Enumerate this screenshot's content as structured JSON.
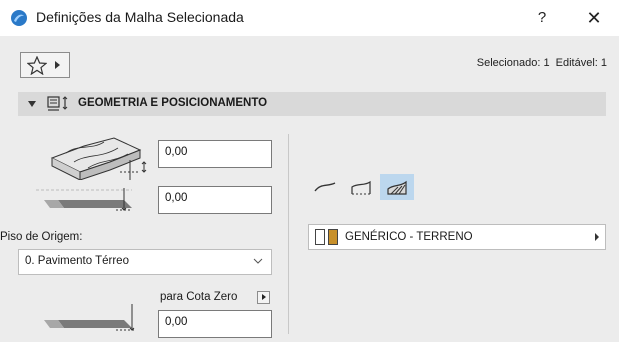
{
  "window": {
    "title": "Definições da Malha Selecionada",
    "help_label": "?",
    "close_label": "✕"
  },
  "toolbar": {
    "favorites_icon": "star-icon",
    "selected_label": "Selecionado: 1",
    "editable_label": "Editável: 1"
  },
  "section": {
    "title": "GEOMETRIA E POSICIONAMENTO",
    "icon": "mesh-geometry-icon"
  },
  "geometry": {
    "top_offset_value": "0,00",
    "bottom_offset_value": "0,00",
    "origin_story_label": "Piso de Origem:",
    "origin_story_value": "0. Pavimento Térreo",
    "zero_level_label": "para Cota Zero",
    "zero_level_value": "0,00"
  },
  "structure": {
    "buttons": [
      "surface-only-icon",
      "top-and-sides-icon",
      "solid-body-icon"
    ],
    "active_index": 2,
    "surface_name": "GENÉRICO - TERRENO",
    "swatch_colors": [
      "#ffffff",
      "#c8902a"
    ]
  },
  "colors": {
    "panel_bg": "#ececec",
    "section_bg": "#d9d9d9",
    "active_button": "#bcd7ee",
    "app_icon": "#2a79c8"
  }
}
